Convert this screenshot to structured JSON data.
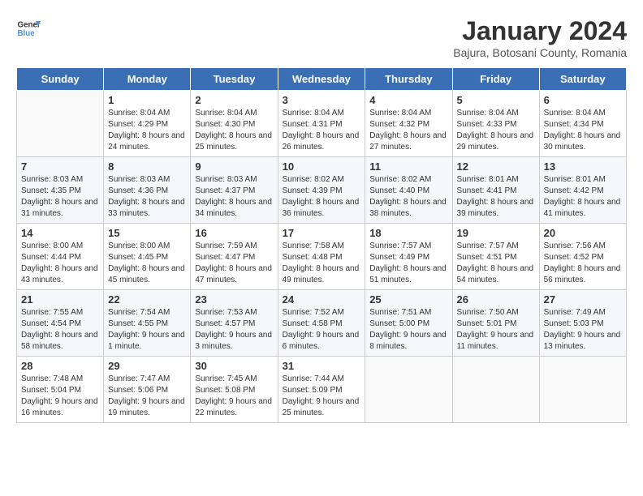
{
  "header": {
    "logo_line1": "General",
    "logo_line2": "Blue",
    "month_title": "January 2024",
    "subtitle": "Bajura, Botosani County, Romania"
  },
  "weekdays": [
    "Sunday",
    "Monday",
    "Tuesday",
    "Wednesday",
    "Thursday",
    "Friday",
    "Saturday"
  ],
  "weeks": [
    [
      {
        "day": "",
        "sunrise": "",
        "sunset": "",
        "daylight": ""
      },
      {
        "day": "1",
        "sunrise": "Sunrise: 8:04 AM",
        "sunset": "Sunset: 4:29 PM",
        "daylight": "Daylight: 8 hours and 24 minutes."
      },
      {
        "day": "2",
        "sunrise": "Sunrise: 8:04 AM",
        "sunset": "Sunset: 4:30 PM",
        "daylight": "Daylight: 8 hours and 25 minutes."
      },
      {
        "day": "3",
        "sunrise": "Sunrise: 8:04 AM",
        "sunset": "Sunset: 4:31 PM",
        "daylight": "Daylight: 8 hours and 26 minutes."
      },
      {
        "day": "4",
        "sunrise": "Sunrise: 8:04 AM",
        "sunset": "Sunset: 4:32 PM",
        "daylight": "Daylight: 8 hours and 27 minutes."
      },
      {
        "day": "5",
        "sunrise": "Sunrise: 8:04 AM",
        "sunset": "Sunset: 4:33 PM",
        "daylight": "Daylight: 8 hours and 29 minutes."
      },
      {
        "day": "6",
        "sunrise": "Sunrise: 8:04 AM",
        "sunset": "Sunset: 4:34 PM",
        "daylight": "Daylight: 8 hours and 30 minutes."
      }
    ],
    [
      {
        "day": "7",
        "sunrise": "Sunrise: 8:03 AM",
        "sunset": "Sunset: 4:35 PM",
        "daylight": "Daylight: 8 hours and 31 minutes."
      },
      {
        "day": "8",
        "sunrise": "Sunrise: 8:03 AM",
        "sunset": "Sunset: 4:36 PM",
        "daylight": "Daylight: 8 hours and 33 minutes."
      },
      {
        "day": "9",
        "sunrise": "Sunrise: 8:03 AM",
        "sunset": "Sunset: 4:37 PM",
        "daylight": "Daylight: 8 hours and 34 minutes."
      },
      {
        "day": "10",
        "sunrise": "Sunrise: 8:02 AM",
        "sunset": "Sunset: 4:39 PM",
        "daylight": "Daylight: 8 hours and 36 minutes."
      },
      {
        "day": "11",
        "sunrise": "Sunrise: 8:02 AM",
        "sunset": "Sunset: 4:40 PM",
        "daylight": "Daylight: 8 hours and 38 minutes."
      },
      {
        "day": "12",
        "sunrise": "Sunrise: 8:01 AM",
        "sunset": "Sunset: 4:41 PM",
        "daylight": "Daylight: 8 hours and 39 minutes."
      },
      {
        "day": "13",
        "sunrise": "Sunrise: 8:01 AM",
        "sunset": "Sunset: 4:42 PM",
        "daylight": "Daylight: 8 hours and 41 minutes."
      }
    ],
    [
      {
        "day": "14",
        "sunrise": "Sunrise: 8:00 AM",
        "sunset": "Sunset: 4:44 PM",
        "daylight": "Daylight: 8 hours and 43 minutes."
      },
      {
        "day": "15",
        "sunrise": "Sunrise: 8:00 AM",
        "sunset": "Sunset: 4:45 PM",
        "daylight": "Daylight: 8 hours and 45 minutes."
      },
      {
        "day": "16",
        "sunrise": "Sunrise: 7:59 AM",
        "sunset": "Sunset: 4:47 PM",
        "daylight": "Daylight: 8 hours and 47 minutes."
      },
      {
        "day": "17",
        "sunrise": "Sunrise: 7:58 AM",
        "sunset": "Sunset: 4:48 PM",
        "daylight": "Daylight: 8 hours and 49 minutes."
      },
      {
        "day": "18",
        "sunrise": "Sunrise: 7:57 AM",
        "sunset": "Sunset: 4:49 PM",
        "daylight": "Daylight: 8 hours and 51 minutes."
      },
      {
        "day": "19",
        "sunrise": "Sunrise: 7:57 AM",
        "sunset": "Sunset: 4:51 PM",
        "daylight": "Daylight: 8 hours and 54 minutes."
      },
      {
        "day": "20",
        "sunrise": "Sunrise: 7:56 AM",
        "sunset": "Sunset: 4:52 PM",
        "daylight": "Daylight: 8 hours and 56 minutes."
      }
    ],
    [
      {
        "day": "21",
        "sunrise": "Sunrise: 7:55 AM",
        "sunset": "Sunset: 4:54 PM",
        "daylight": "Daylight: 8 hours and 58 minutes."
      },
      {
        "day": "22",
        "sunrise": "Sunrise: 7:54 AM",
        "sunset": "Sunset: 4:55 PM",
        "daylight": "Daylight: 9 hours and 1 minute."
      },
      {
        "day": "23",
        "sunrise": "Sunrise: 7:53 AM",
        "sunset": "Sunset: 4:57 PM",
        "daylight": "Daylight: 9 hours and 3 minutes."
      },
      {
        "day": "24",
        "sunrise": "Sunrise: 7:52 AM",
        "sunset": "Sunset: 4:58 PM",
        "daylight": "Daylight: 9 hours and 6 minutes."
      },
      {
        "day": "25",
        "sunrise": "Sunrise: 7:51 AM",
        "sunset": "Sunset: 5:00 PM",
        "daylight": "Daylight: 9 hours and 8 minutes."
      },
      {
        "day": "26",
        "sunrise": "Sunrise: 7:50 AM",
        "sunset": "Sunset: 5:01 PM",
        "daylight": "Daylight: 9 hours and 11 minutes."
      },
      {
        "day": "27",
        "sunrise": "Sunrise: 7:49 AM",
        "sunset": "Sunset: 5:03 PM",
        "daylight": "Daylight: 9 hours and 13 minutes."
      }
    ],
    [
      {
        "day": "28",
        "sunrise": "Sunrise: 7:48 AM",
        "sunset": "Sunset: 5:04 PM",
        "daylight": "Daylight: 9 hours and 16 minutes."
      },
      {
        "day": "29",
        "sunrise": "Sunrise: 7:47 AM",
        "sunset": "Sunset: 5:06 PM",
        "daylight": "Daylight: 9 hours and 19 minutes."
      },
      {
        "day": "30",
        "sunrise": "Sunrise: 7:45 AM",
        "sunset": "Sunset: 5:08 PM",
        "daylight": "Daylight: 9 hours and 22 minutes."
      },
      {
        "day": "31",
        "sunrise": "Sunrise: 7:44 AM",
        "sunset": "Sunset: 5:09 PM",
        "daylight": "Daylight: 9 hours and 25 minutes."
      },
      {
        "day": "",
        "sunrise": "",
        "sunset": "",
        "daylight": ""
      },
      {
        "day": "",
        "sunrise": "",
        "sunset": "",
        "daylight": ""
      },
      {
        "day": "",
        "sunrise": "",
        "sunset": "",
        "daylight": ""
      }
    ]
  ]
}
